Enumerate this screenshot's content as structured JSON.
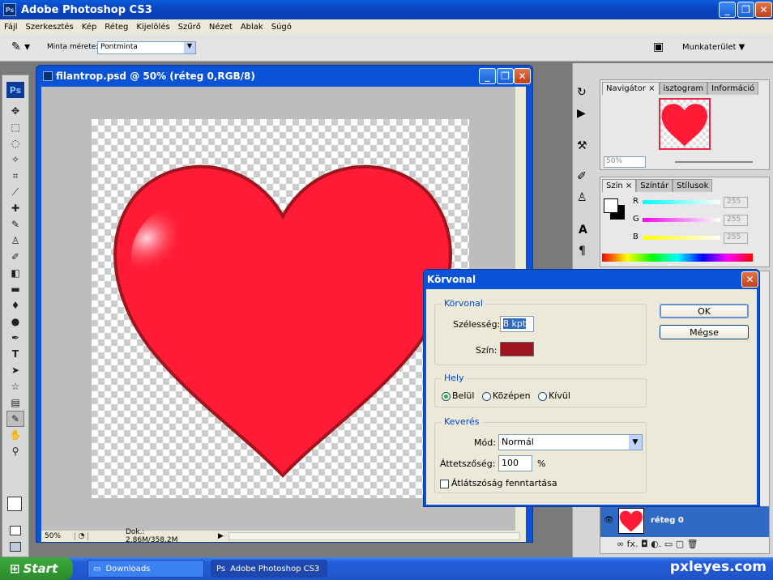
{
  "app": {
    "title": "Adobe Photoshop CS3",
    "icon": "Ps"
  },
  "menu": [
    "Fájl",
    "Szerkesztés",
    "Kép",
    "Réteg",
    "Kijelölés",
    "Szűrő",
    "Nézet",
    "Ablak",
    "Súgó"
  ],
  "options_bar": {
    "sample_size_label": "Minta mérete:",
    "sample_size_value": "Pontminta",
    "workspace_label": "Munkaterület ▼"
  },
  "document": {
    "title": "filantrop.psd @ 50% (réteg 0,RGB/8)",
    "zoom": "50%",
    "doc_info": "Dok.: 2,86M/358,2M"
  },
  "panels": {
    "navigator_tabs": [
      "Navigátor ×",
      "isztogram",
      "Információ"
    ],
    "navigator_zoom": "50%",
    "color_tabs": [
      "Szín ×",
      "Színtár",
      "Stílusok"
    ],
    "color_channels": [
      {
        "label": "R",
        "value": "255"
      },
      {
        "label": "G",
        "value": "255"
      },
      {
        "label": "B",
        "value": "255"
      }
    ],
    "layer_name": "réteg 0",
    "layer_icons": "∞ fx. ◘ ◐. ▭ ▢ 🗑"
  },
  "dialog": {
    "title": "Körvonal",
    "ok": "OK",
    "cancel": "Mégse",
    "group_stroke": "Körvonal",
    "width_label": "Szélesség:",
    "width_value": "8 kpt",
    "color_label": "Szín:",
    "stroke_color": "#a0141e",
    "group_location": "Hely",
    "loc_inside": "Belül",
    "loc_center": "Középen",
    "loc_outside": "Kívül",
    "group_blend": "Keverés",
    "mode_label": "Mód:",
    "mode_value": "Normál",
    "opacity_label": "Áttetszőség:",
    "opacity_value": "100",
    "opacity_unit": "%",
    "preserve_label": "Átlátszóság fenntartása"
  },
  "taskbar": {
    "start": "Start",
    "items": [
      "Downloads",
      "Adobe Photoshop CS3"
    ]
  },
  "watermark": "pxleyes.com",
  "colors": {
    "heart": "#ff1a35",
    "accent": "#0a53d6"
  }
}
